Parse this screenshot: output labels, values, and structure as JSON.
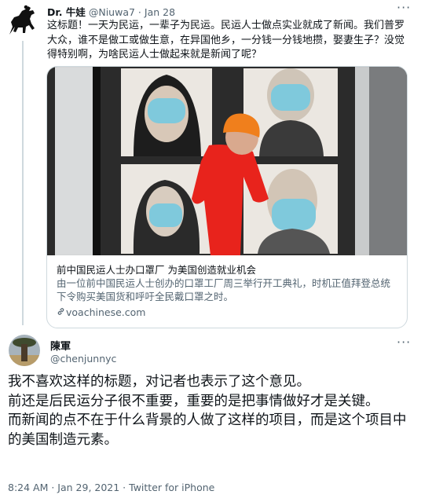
{
  "tweet1": {
    "name": "Dr. 牛娃",
    "handle": "@Niuwa7",
    "separator": "·",
    "date": "Jan 28",
    "more": "···",
    "text": "这标题！一天为民运，一辈子为民运。民运人士做点实业就成了新闻。我们普罗大众，谁不是做工或做生意，在异国他乡，一分钱一分钱地攒，娶妻生子？没觉得特别啊，为啥民运人士做起来就是新闻了呢？",
    "card": {
      "title": "前中国民运人士办口罩厂 为美国创造就业机会",
      "description": "由一位前中国民运人士创办的口罩工厂周三举行开工典礼，时机正值拜登总统下令购买美国货和呼吁全民戴口罩之时。",
      "link_icon": "link-icon",
      "domain": "voachinese.com"
    }
  },
  "tweet2": {
    "name": "陳軍",
    "handle": "@chenjunnyc",
    "more": "···",
    "lines": [
      "我不喜欢这样的标题，对记者也表示了这个意见。",
      "前还是后民运分子很不重要，重要的是把事情做好才是关键。",
      "而新闻的点不在于什么背景的人做了这样的项目，而是这个项目中的美国制造元素。"
    ],
    "meta": "8:24 AM · Jan 29, 2021 · Twitter for iPhone"
  },
  "colors": {
    "text": "#0f1419",
    "secondary": "#536471",
    "border": "#cfd9de",
    "mask": "#7fc9dc",
    "runner_shirt": "#e8231c",
    "runner_hat": "#f07f1c"
  }
}
